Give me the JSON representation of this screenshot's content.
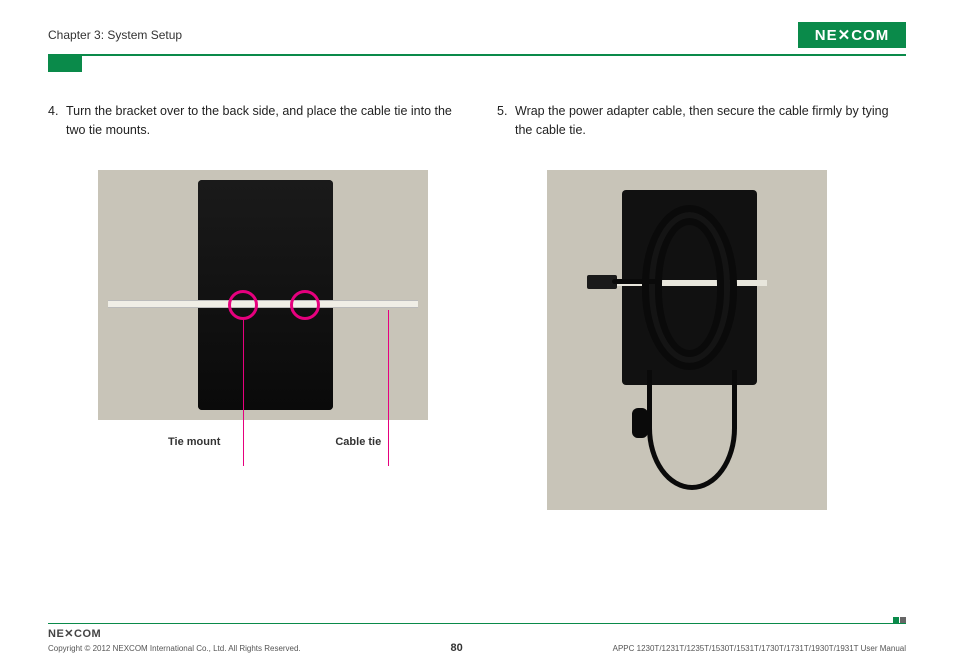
{
  "header": {
    "chapter": "Chapter 3: System Setup",
    "logo_text": "NE✕COM"
  },
  "left": {
    "step_num": "4.",
    "step_text": "Turn the bracket over to the back side, and place the cable tie into the two tie mounts.",
    "label_tie_mount": "Tie mount",
    "label_cable_tie": "Cable tie"
  },
  "right": {
    "step_num": "5.",
    "step_text": "Wrap the power adapter cable, then secure the cable firmly by tying the cable tie."
  },
  "footer": {
    "logo_text": "NE✕COM",
    "copyright": "Copyright © 2012 NEXCOM International Co., Ltd. All Rights Reserved.",
    "page": "80",
    "manual": "APPC 1230T/1231T/1235T/1530T/1531T/1730T/1731T/1930T/1931T User Manual"
  }
}
